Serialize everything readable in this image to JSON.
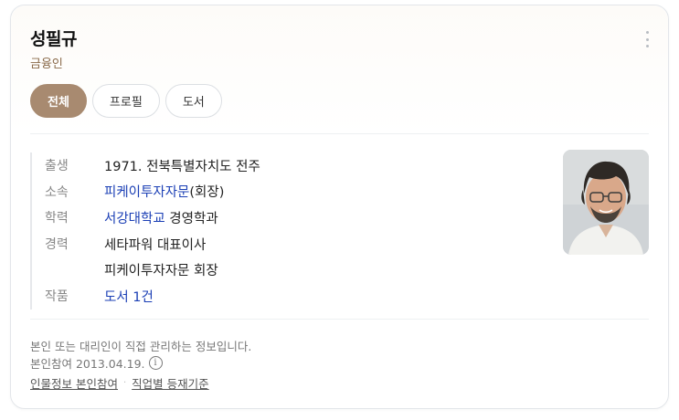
{
  "profile": {
    "name": "성필규",
    "subtitle": "금융인"
  },
  "tabs": [
    {
      "label": "전체",
      "active": true
    },
    {
      "label": "프로필",
      "active": false
    },
    {
      "label": "도서",
      "active": false
    }
  ],
  "info": [
    {
      "label": "출생",
      "value": "1971. 전북특별자치도 전주"
    },
    {
      "label": "소속",
      "link": "피케이투자자문",
      "suffix": "(회장)"
    },
    {
      "label": "학력",
      "link": "서강대학교",
      "suffix": " 경영학과"
    },
    {
      "label": "경력",
      "value": "세타파워 대표이사"
    },
    {
      "label": "",
      "value": "피케이투자자문 회장"
    },
    {
      "label": "작품",
      "link": "도서 1건"
    }
  ],
  "footer": {
    "notice": "본인 또는 대리인이 직접 관리하는 정보입니다.",
    "participation": "본인참여 2013.04.19.",
    "info_icon_glyph": "i",
    "link_participation": "인물정보 본인참여",
    "separator": "·",
    "link_criteria": "직업별 등재기준"
  },
  "colors": {
    "active_tab": "#a88a70",
    "link": "#1b3fb5",
    "subtitle": "#8a6a4a"
  },
  "icons": {
    "more": "more-vertical-icon",
    "info": "info-circle-icon"
  }
}
